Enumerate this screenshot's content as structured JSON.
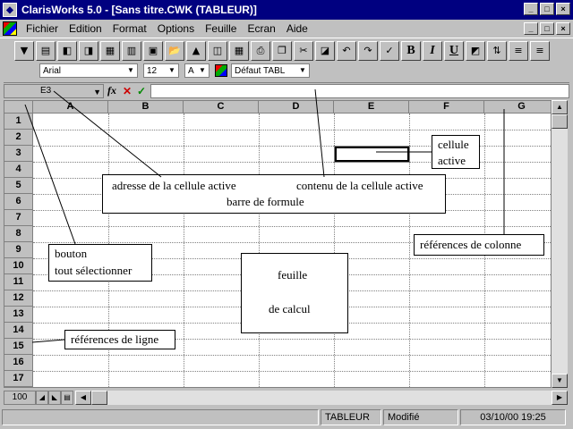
{
  "window": {
    "title": "ClarisWorks 5.0 - [Sans titre.CWK (TABLEUR)]",
    "minimize": "_",
    "maximize": "□",
    "close": "×"
  },
  "menu": {
    "items": [
      "Fichier",
      "Edition",
      "Format",
      "Options",
      "Feuille",
      "Ecran",
      "Aide"
    ]
  },
  "toolbar": {
    "bold": "B",
    "italic": "I",
    "underline": "U"
  },
  "format_bar": {
    "font": "Arial",
    "size": "12",
    "text_color": "A",
    "style": "Défaut TABL"
  },
  "entry_bar": {
    "cell_ref": "E3",
    "fx": "fx",
    "cancel": "✕",
    "accept": "✓",
    "content": ""
  },
  "grid": {
    "columns": [
      "A",
      "B",
      "C",
      "D",
      "E",
      "F",
      "G"
    ],
    "rows": [
      "1",
      "2",
      "3",
      "4",
      "5",
      "6",
      "7",
      "8",
      "9",
      "10",
      "11",
      "12",
      "13",
      "14",
      "15",
      "16",
      "17"
    ],
    "active_cell": "E3"
  },
  "bottom_bar": {
    "zoom": "100"
  },
  "status_bar": {
    "mode": "TABLEUR",
    "state": "Modifié",
    "datetime": "03/10/00 19:25"
  },
  "annotations": {
    "active_cell": [
      "cellule",
      "active"
    ],
    "address": "adresse de la cellule active",
    "content": "contenu de la cellule active",
    "formula_bar": "barre de formule",
    "column_refs": "références de colonne",
    "select_all": [
      "bouton",
      "tout sélectionner"
    ],
    "sheet": [
      "feuille",
      "de calcul"
    ],
    "row_refs": "références de ligne"
  }
}
